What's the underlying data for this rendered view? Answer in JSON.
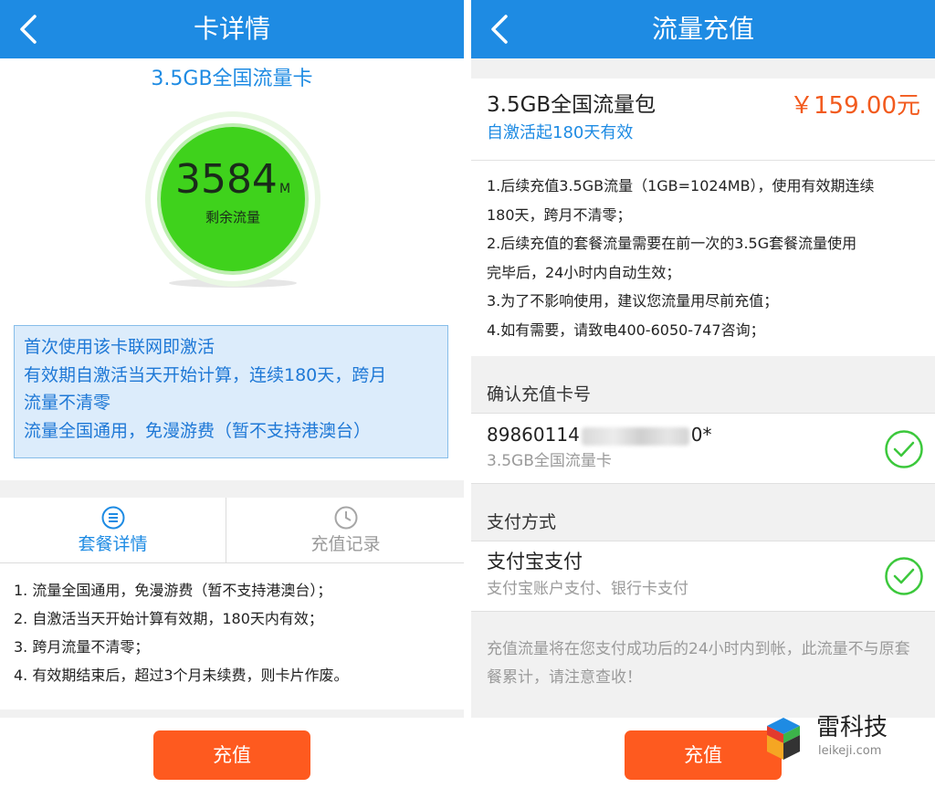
{
  "left": {
    "title": "卡详情",
    "card_name": "3.5GB全国流量卡",
    "gauge": {
      "value": "3584",
      "unit": "M",
      "label": "剩余流量"
    },
    "notice": [
      "首次使用该卡联网即激活",
      "有效期自激活当天开始计算，连续180天，跨月",
      "流量不清零",
      "流量全国通用，免漫游费（暂不支持港澳台）"
    ],
    "tabs": [
      {
        "label": "套餐详情",
        "icon": "list-icon",
        "active": true
      },
      {
        "label": "充值记录",
        "icon": "clock-icon",
        "active": false
      }
    ],
    "rules": [
      "1. 流量全国通用，免漫游费（暂不支持港澳台）；",
      "2. 自激活当天开始计算有效期，180天内有效；",
      "3. 跨月流量不清零；",
      "4. 有效期结束后，超过3个月未续费，则卡片作废。"
    ],
    "button": "充值"
  },
  "right": {
    "title": "流量充值",
    "package": {
      "name": "3.5GB全国流量包",
      "price": "￥159.00元",
      "validity": "自激活起180天有效",
      "description": [
        "1.后续充值3.5GB流量（1GB=1024MB），使用有效期连续",
        "180天，跨月不清零；",
        "2.后续充值的套餐流量需要在前一次的3.5G套餐流量使用",
        "完毕后，24小时内自动生效；",
        "3.为了不影响使用，建议您流量用尽前充值；",
        "4.如有需要，请致电400-6050-747咨询；"
      ]
    },
    "card_section": {
      "heading": "确认充值卡号",
      "number_prefix": "89860114",
      "number_suffix": "0*",
      "card_type": "3.5GB全国流量卡"
    },
    "payment_section": {
      "heading": "支付方式",
      "method": "支付宝支付",
      "detail": "支付宝账户支付、银行卡支付"
    },
    "footnote": "充值流量将在您支付成功后的24小时内到帐，此流量不与原套餐累计，请注意查收！",
    "button": "充值"
  },
  "watermark": {
    "name": "雷科技",
    "url": "leikeji.com"
  },
  "colors": {
    "header_blue": "#1e8be3",
    "accent_orange": "#fe5a1f",
    "price_orange": "#f25a1d",
    "gauge_green": "#3fd21c",
    "check_green": "#3cc83c"
  }
}
